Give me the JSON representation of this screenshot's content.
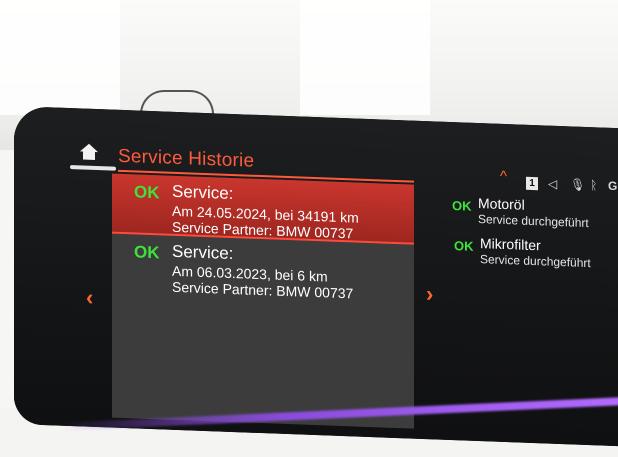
{
  "header": {
    "title": "Service Historie"
  },
  "icons": {
    "home": "home-icon",
    "left": "chevron-left-icon",
    "right": "chevron-right-icon",
    "up": "chevron-up-icon",
    "speaker": "speaker-icon",
    "mic": "microphone-icon",
    "signal": "signal-icon"
  },
  "statusbar": {
    "up": "^",
    "profile": "1",
    "speaker": "◁",
    "mic": "🎙",
    "signal": "ᚱ",
    "extra": "G"
  },
  "history": [
    {
      "status": "OK",
      "title": "Service:",
      "date_line": "Am 24.05.2024, bei 34191 km",
      "partner_line": "Service Partner: BMW 00737",
      "selected": true
    },
    {
      "status": "OK",
      "title": "Service:",
      "date_line": "Am 06.03.2023, bei 6 km",
      "partner_line": "Service Partner: BMW 00737",
      "selected": false
    }
  ],
  "details": [
    {
      "status": "OK",
      "title": "Motoröl",
      "subtitle": "Service durchgeführt"
    },
    {
      "status": "OK",
      "title": "Mikrofilter",
      "subtitle": "Service durchgeführt"
    }
  ],
  "colors": {
    "accent": "#ff5a3c",
    "ok": "#3ee23a",
    "selected_bg": "#c9362d",
    "ambient": "#8a4bdc"
  }
}
